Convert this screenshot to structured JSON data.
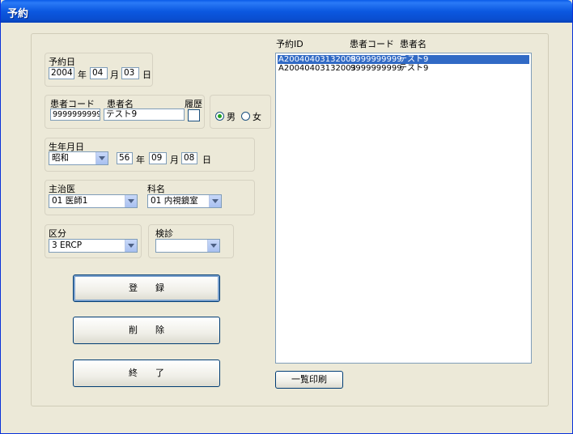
{
  "window": {
    "title": "予約"
  },
  "reservation_date": {
    "group_label": "予約日",
    "year": "2004",
    "year_unit": "年",
    "month": "04",
    "month_unit": "月",
    "day": "03",
    "day_unit": "日"
  },
  "patient": {
    "code_label": "患者コード",
    "name_label": "患者名",
    "history_label": "履歴",
    "code_value": "9999999999",
    "name_value": "テスト9"
  },
  "sex": {
    "male_label": "男",
    "female_label": "女",
    "selected": "male"
  },
  "birth": {
    "group_label": "生年月日",
    "era": "昭和",
    "year": "56",
    "year_unit": "年",
    "month": "09",
    "month_unit": "月",
    "day": "08",
    "day_unit": "日"
  },
  "doctor": {
    "label": "主治医",
    "value": "01 医師1"
  },
  "department": {
    "label": "科名",
    "value": "01 内視鏡室"
  },
  "category": {
    "label": "区分",
    "value": "3 ERCP"
  },
  "exam": {
    "label": "検診",
    "value": ""
  },
  "buttons": {
    "register": "登　　録",
    "delete": "削　　除",
    "exit": "終　　了",
    "print_list": "一覧印刷"
  },
  "reservation_list": {
    "headers": [
      "予約ID",
      "患者コード",
      "患者名"
    ],
    "rows": [
      [
        "A20040403132008",
        "9999999999",
        "テスト9"
      ],
      [
        "A20040403132003",
        "9999999999",
        "テスト9"
      ]
    ],
    "selected_index": 0
  }
}
